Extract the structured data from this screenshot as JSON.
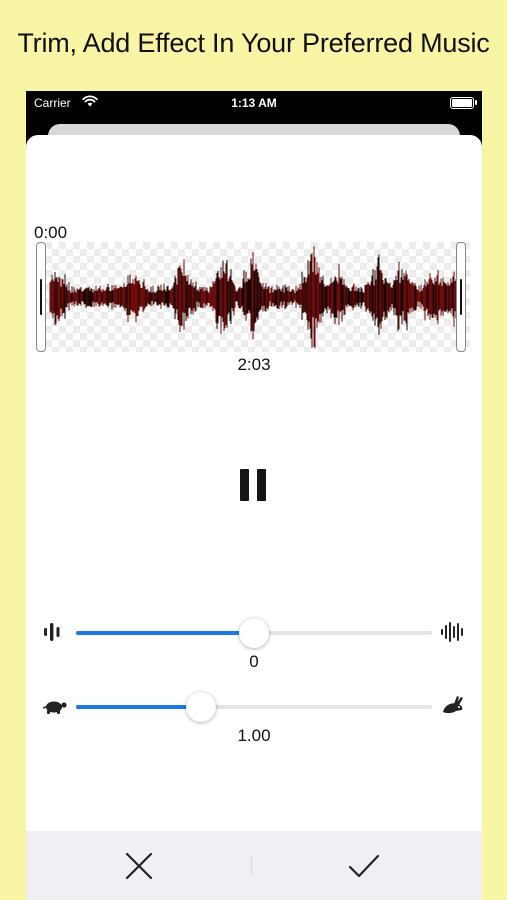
{
  "headline": "Trim, Add Effect In Your Preferred Music",
  "status_bar": {
    "carrier": "Carrier",
    "time": "1:13 AM"
  },
  "trimmer": {
    "start_time": "0:00",
    "end_time": "2:03"
  },
  "player": {
    "state_icon": "pause-icon"
  },
  "volume": {
    "icon_left": "low-volume-wave-icon",
    "icon_right": "high-volume-wave-icon",
    "value_label": "0",
    "position": 0.5
  },
  "speed": {
    "icon_left": "turtle-icon",
    "icon_right": "rabbit-icon",
    "value_label": "1.00",
    "position": 0.35
  },
  "actions": {
    "cancel_icon": "close-icon",
    "confirm_icon": "checkmark-icon"
  },
  "colors": {
    "page_background": "#f8f5a4",
    "accent": "#1b78e2",
    "waveform": "#6b0d0d"
  }
}
